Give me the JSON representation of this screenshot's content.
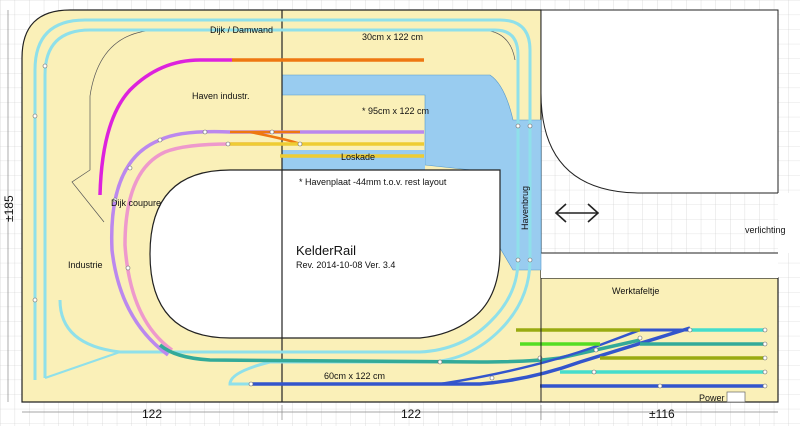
{
  "title": "KelderRail",
  "revision": "Rev. 2014-10-08 Ver. 3.4",
  "labels": {
    "dijk_damwand": "Dijk / Damwand",
    "size_top": "30cm x 122 cm",
    "haven_industr": "Haven industr.",
    "size_harbor": "* 95cm x 122 cm",
    "loskade": "Loskade",
    "havenplaat_note": "* Havenplaat -44mm t.o.v. rest layout",
    "dijk_coupure": "Dijk coupure",
    "industrie": "Industrie",
    "havenbrug": "Havenbrug",
    "verlichting": "verlichting",
    "werktafeltje": "Werktafeltje",
    "size_bottom": "60cm x 122 cm",
    "power": "Power"
  },
  "dimensions": {
    "height": "185",
    "height_prefix": "±",
    "bottom_1": "122",
    "bottom_2": "122",
    "bottom_3": "116",
    "bottom_3_prefix": "±"
  },
  "colors": {
    "board": "#faf0b8",
    "water": "#99ccf0",
    "track_outer": "#8fe0ea",
    "track_magenta": "#dd22dd",
    "track_purple": "#bb88ee",
    "track_pink": "#ee99cc",
    "track_orange": "#ee7711",
    "track_yellow": "#eecc33",
    "track_blue": "#3355cc",
    "track_teal": "#33aa99",
    "track_green": "#55dd22",
    "track_olive": "#99aa11",
    "track_cyan": "#44ddcc"
  }
}
